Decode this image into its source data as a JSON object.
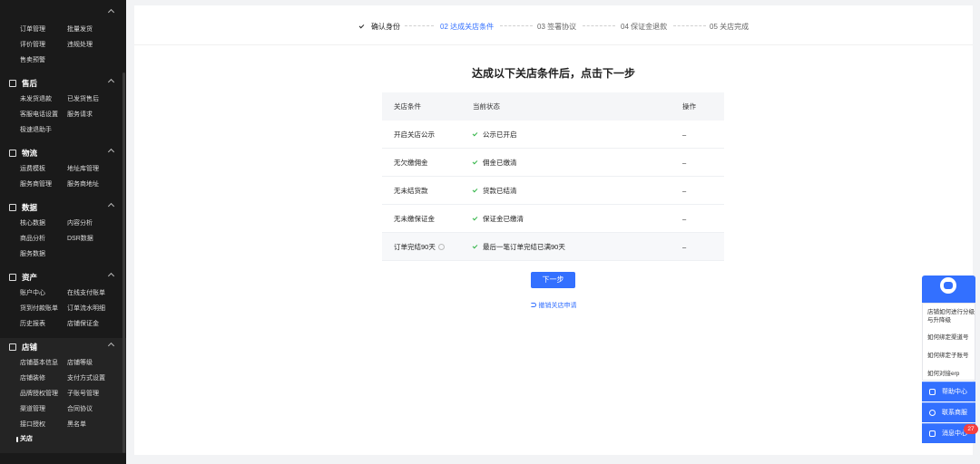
{
  "sidebar": {
    "top_items": [
      "订单管理",
      "批量发货",
      "评价管理",
      "违规处理",
      "售卖预警"
    ],
    "sections": [
      {
        "title": "售后",
        "icon": "after-sale-icon",
        "items": [
          "未发货退款",
          "已发货售后",
          "客服电话设置",
          "服务请求",
          "极速退助手"
        ]
      },
      {
        "title": "物流",
        "icon": "logistics-icon",
        "items": [
          "运费模板",
          "地址库管理",
          "服务商管理",
          "服务商地址"
        ]
      },
      {
        "title": "数据",
        "icon": "chart-icon",
        "items": [
          "核心数据",
          "内容分析",
          "商品分析",
          "DSR数据",
          "服务数据"
        ]
      },
      {
        "title": "资产",
        "icon": "wallet-icon",
        "items": [
          "账户中心",
          "在线支付账单",
          "货到付款账单",
          "订单流水明细",
          "历史报表",
          "店铺保证金"
        ]
      },
      {
        "title": "店铺",
        "icon": "store-icon",
        "items": [
          "店铺基本信息",
          "店铺等级",
          "店铺装修",
          "支付方式设置",
          "品牌授权管理",
          "子账号管理",
          "渠道管理",
          "合同协议",
          "接口授权",
          "黑名单",
          "关店"
        ]
      }
    ],
    "active_item": "关店"
  },
  "steps": [
    {
      "label": "确认身份",
      "state": "done"
    },
    {
      "label": "02 达成关店条件",
      "state": "current"
    },
    {
      "label": "03 签署协议",
      "state": "todo"
    },
    {
      "label": "04 保证金退款",
      "state": "todo"
    },
    {
      "label": "05 关店完成",
      "state": "todo"
    }
  ],
  "heading": "达成以下关店条件后，点击下一步",
  "table": {
    "headers": [
      "关店条件",
      "当前状态",
      "操作"
    ],
    "rows": [
      {
        "condition": "开启关店公示",
        "status": "公示已开启",
        "action": "–"
      },
      {
        "condition": "无欠缴佣金",
        "status": "佣金已缴清",
        "action": "–"
      },
      {
        "condition": "无未结货款",
        "status": "货款已结清",
        "action": "–"
      },
      {
        "condition": "无未缴保证金",
        "status": "保证金已缴清",
        "action": "–"
      },
      {
        "condition": "订单完结90天",
        "status": "最后一笔订单完结已满90天",
        "action": "–"
      }
    ]
  },
  "next_button": "下一步",
  "revoke_link": "撤销关店申请",
  "helper": {
    "faqs": [
      "店铺如何进行分级与升降级",
      "如何绑定渠道号",
      "如何绑定子账号",
      "如何对接erp"
    ],
    "buttons": [
      "帮助中心",
      "联系商服",
      "消息中心"
    ],
    "message_badge": "27"
  },
  "colors": {
    "accent": "#3370ff",
    "success": "#2fb344",
    "sidebar_bg": "#1a1a1a",
    "badge": "#f53f3f"
  }
}
